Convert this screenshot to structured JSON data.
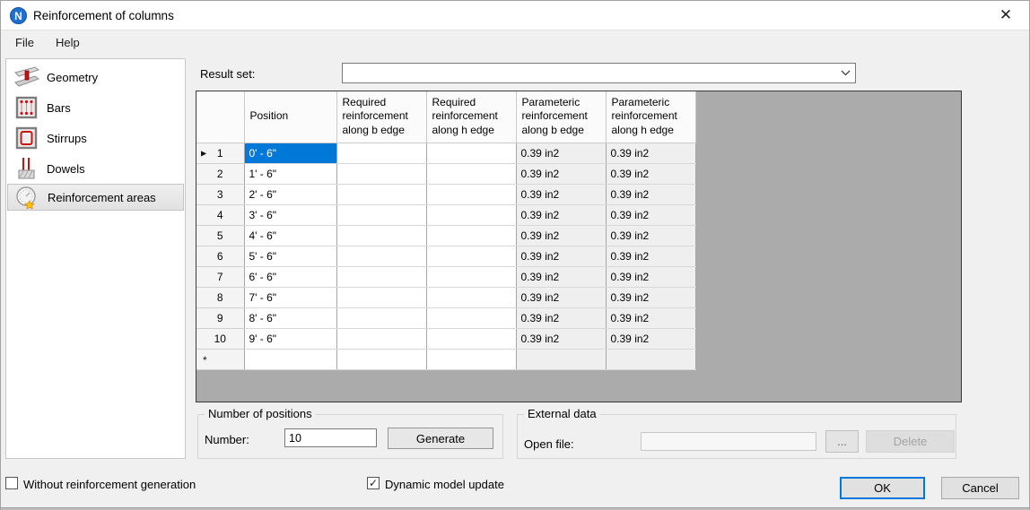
{
  "window": {
    "title": "Reinforcement of columns",
    "close_glyph": "✕",
    "app_initial": "N"
  },
  "menu": {
    "file": "File",
    "help": "Help"
  },
  "sidebar": {
    "items": [
      {
        "label": "Geometry",
        "icon": "geometry-icon",
        "selected": false
      },
      {
        "label": "Bars",
        "icon": "bars-icon",
        "selected": false
      },
      {
        "label": "Stirrups",
        "icon": "stirrups-icon",
        "selected": false
      },
      {
        "label": "Dowels",
        "icon": "dowels-icon",
        "selected": false
      },
      {
        "label": "Reinforcement areas",
        "icon": "gauge-star-icon",
        "selected": true
      }
    ]
  },
  "result_set": {
    "label": "Result set:",
    "value": ""
  },
  "grid": {
    "columns": [
      "",
      "Position",
      "Required reinforcement along b edge",
      "Required reinforcement along h edge",
      "Parameteric reinforcement along b edge",
      "Parameteric reinforcement along h edge"
    ],
    "rows": [
      {
        "header": "1",
        "marker": "▶",
        "selected": true,
        "position": "0' - 6\"",
        "required_b": "",
        "required_h": "",
        "parametric_b": "0.39 in2",
        "parametric_h": "0.39 in2"
      },
      {
        "header": "2",
        "marker": "",
        "selected": false,
        "position": "1' - 6\"",
        "required_b": "",
        "required_h": "",
        "parametric_b": "0.39 in2",
        "parametric_h": "0.39 in2"
      },
      {
        "header": "3",
        "marker": "",
        "selected": false,
        "position": "2' - 6\"",
        "required_b": "",
        "required_h": "",
        "parametric_b": "0.39 in2",
        "parametric_h": "0.39 in2"
      },
      {
        "header": "4",
        "marker": "",
        "selected": false,
        "position": "3' - 6\"",
        "required_b": "",
        "required_h": "",
        "parametric_b": "0.39 in2",
        "parametric_h": "0.39 in2"
      },
      {
        "header": "5",
        "marker": "",
        "selected": false,
        "position": "4' - 6\"",
        "required_b": "",
        "required_h": "",
        "parametric_b": "0.39 in2",
        "parametric_h": "0.39 in2"
      },
      {
        "header": "6",
        "marker": "",
        "selected": false,
        "position": "5' - 6\"",
        "required_b": "",
        "required_h": "",
        "parametric_b": "0.39 in2",
        "parametric_h": "0.39 in2"
      },
      {
        "header": "7",
        "marker": "",
        "selected": false,
        "position": "6' - 6\"",
        "required_b": "",
        "required_h": "",
        "parametric_b": "0.39 in2",
        "parametric_h": "0.39 in2"
      },
      {
        "header": "8",
        "marker": "",
        "selected": false,
        "position": "7' - 6\"",
        "required_b": "",
        "required_h": "",
        "parametric_b": "0.39 in2",
        "parametric_h": "0.39 in2"
      },
      {
        "header": "9",
        "marker": "",
        "selected": false,
        "position": "8' - 6\"",
        "required_b": "",
        "required_h": "",
        "parametric_b": "0.39 in2",
        "parametric_h": "0.39 in2"
      },
      {
        "header": "10",
        "marker": "",
        "selected": false,
        "position": "9' - 6\"",
        "required_b": "",
        "required_h": "",
        "parametric_b": "0.39 in2",
        "parametric_h": "0.39 in2"
      },
      {
        "header": "*",
        "marker": "",
        "selected": false,
        "is_new": true,
        "position": "",
        "required_b": "",
        "required_h": "",
        "parametric_b": "",
        "parametric_h": ""
      }
    ]
  },
  "positions_group": {
    "title": "Number of positions",
    "number_label": "Number:",
    "number_value": "10",
    "generate_label": "Generate"
  },
  "external_group": {
    "title": "External data",
    "open_file_label": "Open file:",
    "open_file_value": "",
    "browse_label": "...",
    "delete_label": "Delete"
  },
  "footer": {
    "without_reinforcement": {
      "label": "Without reinforcement generation",
      "checked": false
    },
    "dynamic_update": {
      "label": "Dynamic model update",
      "checked": true
    },
    "ok_label": "OK",
    "cancel_label": "Cancel"
  },
  "colors": {
    "accent": "#0078d7",
    "selected_cell_bg": "#0078d7",
    "selected_cell_text": "#ffffff",
    "grid_backdrop": "#ababab",
    "parametric_cell_bg": "#efefef",
    "dialog_bg": "#f0f0f0",
    "titlebar_bg": "#ffffff",
    "icon_red": "#cc1111",
    "icon_gray": "#8f8f8f",
    "star_yellow": "#ffc400"
  }
}
